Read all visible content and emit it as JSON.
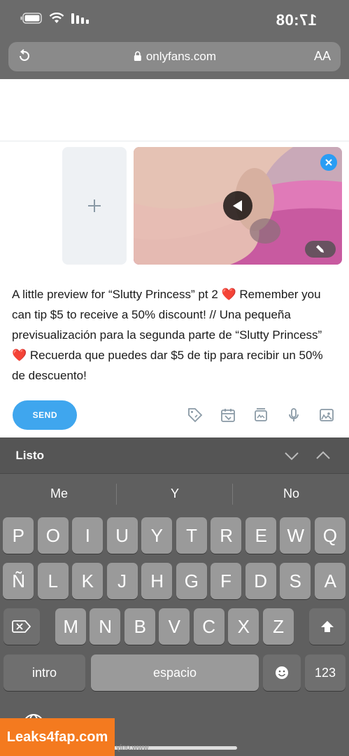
{
  "status_bar": {
    "time": "17:08"
  },
  "browser": {
    "url": "onlyfans.com",
    "text_size_label": "AA"
  },
  "post": {
    "message": "A little preview for “Slutty Princess” pt 2 ❤️ Remember you can tip $5 to receive a 50% discount! // Una pequeña previsualización para la segunda parte de “Slutty Princess” ❤️ Recuerda que puedes dar $5 de tip para recibir un 50% de descuento!",
    "send_label": "SEND"
  },
  "keyboard": {
    "done_label": "Listo",
    "suggestions": [
      "No",
      "Y",
      "Me"
    ],
    "row1": [
      "Q",
      "W",
      "E",
      "R",
      "T",
      "Y",
      "U",
      "I",
      "O",
      "P"
    ],
    "row2": [
      "A",
      "S",
      "D",
      "F",
      "G",
      "H",
      "J",
      "K",
      "L",
      "Ñ"
    ],
    "row3": [
      "Z",
      "X",
      "C",
      "V",
      "B",
      "N",
      "M"
    ],
    "numbers_label": "123",
    "space_label": "espacio",
    "return_label": "intro"
  },
  "watermark": {
    "logo_text": "Leaks4fap.com",
    "small_text": "www.only"
  },
  "colors": {
    "accent": "#3fa6ee",
    "chrome": "#6b6b6b",
    "keyboard": "#5f5f5f",
    "watermark": "#f47a1f"
  }
}
